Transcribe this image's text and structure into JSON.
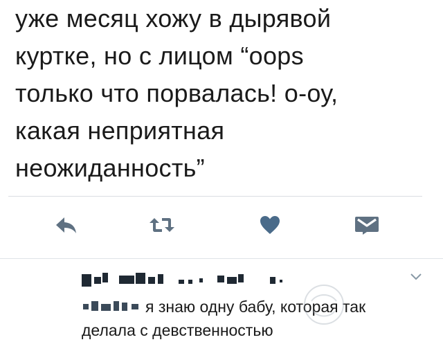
{
  "tweet": {
    "lines": [
      "уже месяц хожу в дырявой",
      "куртке, но с лицом “oops",
      "только что порвалась! о-оу,",
      "какая неприятная",
      "неожиданность”"
    ]
  },
  "actions": {
    "reply": "reply-icon",
    "retweet": "retweet-icon",
    "like": "heart-icon",
    "dm": "envelope-icon",
    "icon_color": "#657786",
    "heart_color": "#4a6b8a"
  },
  "reply": {
    "lines": [
      "я знаю одну бабу, которая так",
      "делала с девственностью"
    ]
  }
}
